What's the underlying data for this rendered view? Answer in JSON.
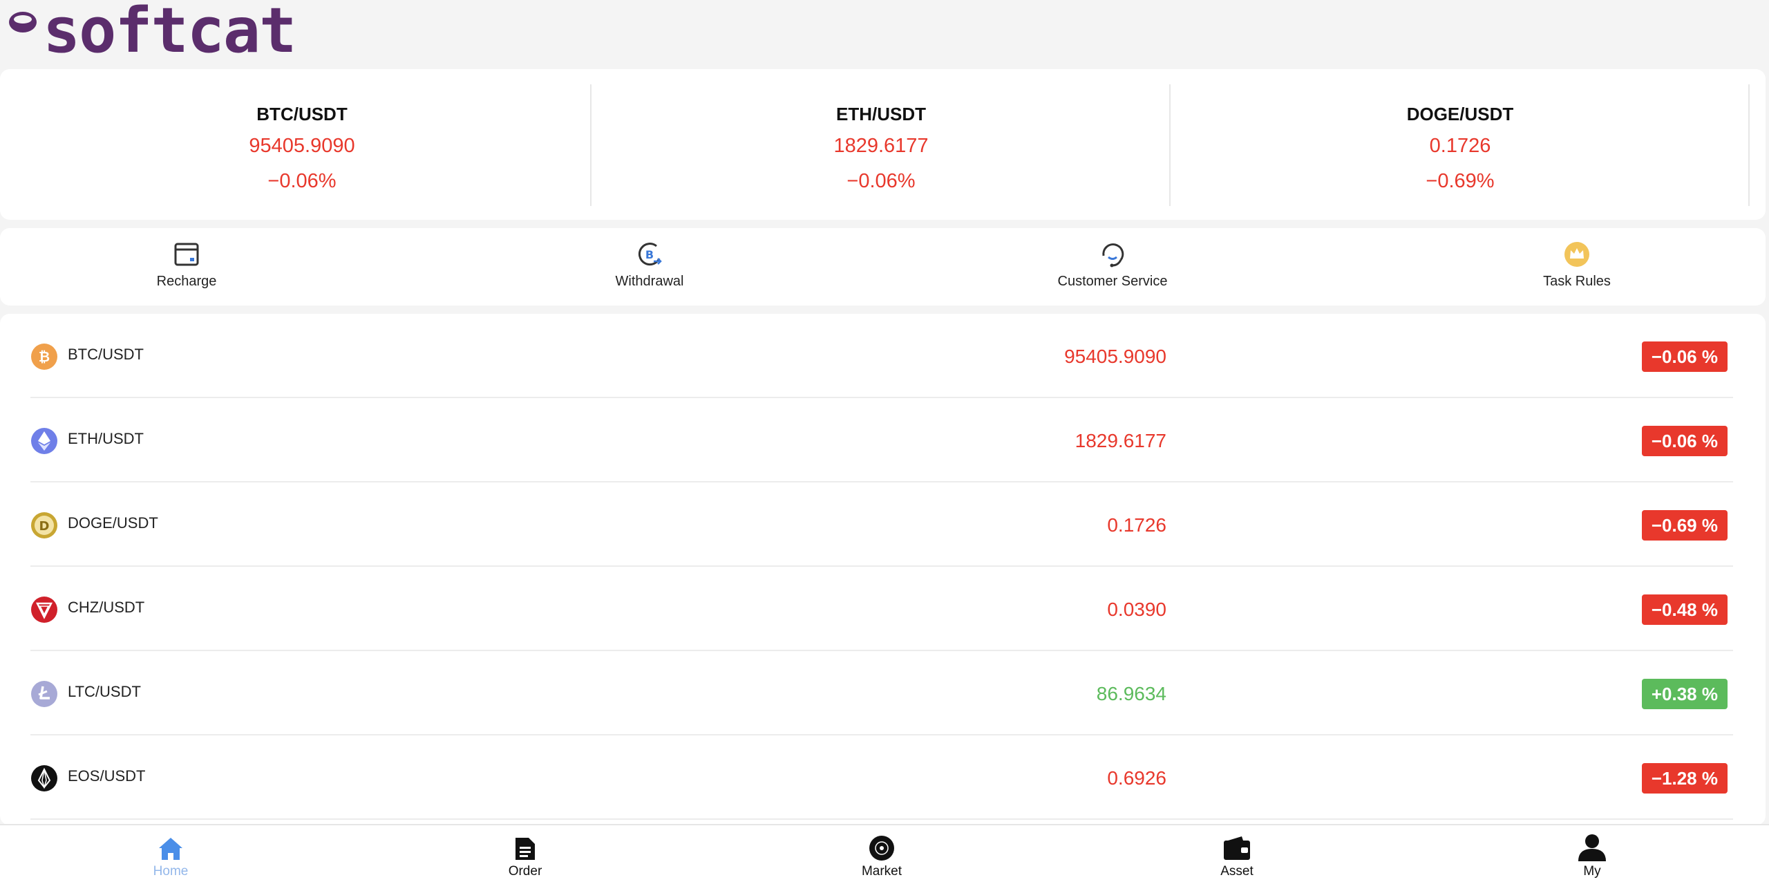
{
  "brand": {
    "name": "softcat",
    "color": "#5b2d6c"
  },
  "colors": {
    "down": "#e8382c",
    "up": "#5cbb5c",
    "active_nav": "#4a8ee8",
    "active_nav_label": "#93b7ea"
  },
  "tickers": [
    {
      "pair": "BTC/USDT",
      "price": "95405.9090",
      "change": "−0.06%"
    },
    {
      "pair": "ETH/USDT",
      "price": "1829.6177",
      "change": "−0.06%"
    },
    {
      "pair": "DOGE/USDT",
      "price": "0.1726",
      "change": "−0.69%"
    }
  ],
  "actions": [
    {
      "label": "Recharge",
      "icon": "wallet-card-icon"
    },
    {
      "label": "Withdrawal",
      "icon": "bitcoin-withdraw-icon"
    },
    {
      "label": "Customer Service",
      "icon": "headset-icon"
    },
    {
      "label": "Task Rules",
      "icon": "crown-icon"
    }
  ],
  "market": [
    {
      "pair": "BTC/USDT",
      "price": "95405.9090",
      "change": "−0.06 %",
      "direction": "down",
      "icon": "bitcoin-icon"
    },
    {
      "pair": "ETH/USDT",
      "price": "1829.6177",
      "change": "−0.06 %",
      "direction": "down",
      "icon": "ethereum-icon"
    },
    {
      "pair": "DOGE/USDT",
      "price": "0.1726",
      "change": "−0.69 %",
      "direction": "down",
      "icon": "dogecoin-icon"
    },
    {
      "pair": "CHZ/USDT",
      "price": "0.0390",
      "change": "−0.48 %",
      "direction": "down",
      "icon": "chiliz-icon"
    },
    {
      "pair": "LTC/USDT",
      "price": "86.9634",
      "change": "+0.38 %",
      "direction": "up",
      "icon": "litecoin-icon"
    },
    {
      "pair": "EOS/USDT",
      "price": "0.6926",
      "change": "−1.28 %",
      "direction": "down",
      "icon": "eos-icon"
    }
  ],
  "nav": [
    {
      "label": "Home",
      "icon": "home-icon",
      "active": true
    },
    {
      "label": "Order",
      "icon": "document-icon",
      "active": false
    },
    {
      "label": "Market",
      "icon": "market-icon",
      "active": false
    },
    {
      "label": "Asset",
      "icon": "wallet-icon",
      "active": false
    },
    {
      "label": "My",
      "icon": "user-icon",
      "active": false
    }
  ]
}
